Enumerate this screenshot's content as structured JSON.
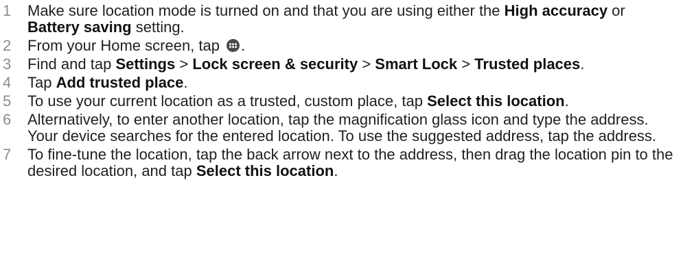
{
  "steps": [
    {
      "num": "1",
      "parts": [
        {
          "t": "Make sure location mode is turned on and that you are using either the "
        },
        {
          "t": "High accuracy",
          "b": true
        },
        {
          "t": " or "
        },
        {
          "t": "Battery saving",
          "b": true
        },
        {
          "t": " setting."
        }
      ]
    },
    {
      "num": "2",
      "parts": [
        {
          "t": "From your Home screen, tap "
        },
        {
          "icon": "apps-grid-icon"
        },
        {
          "t": "."
        }
      ]
    },
    {
      "num": "3",
      "parts": [
        {
          "t": "Find and tap "
        },
        {
          "t": "Settings",
          "b": true
        },
        {
          "t": " > "
        },
        {
          "t": "Lock screen & security",
          "b": true
        },
        {
          "t": " > "
        },
        {
          "t": "Smart Lock",
          "b": true
        },
        {
          "t": " > "
        },
        {
          "t": "Trusted places",
          "b": true
        },
        {
          "t": "."
        }
      ]
    },
    {
      "num": "4",
      "parts": [
        {
          "t": "Tap "
        },
        {
          "t": "Add trusted place",
          "b": true
        },
        {
          "t": "."
        }
      ]
    },
    {
      "num": "5",
      "parts": [
        {
          "t": "To use your current location as a trusted, custom place, tap "
        },
        {
          "t": "Select this location",
          "b": true
        },
        {
          "t": "."
        }
      ]
    },
    {
      "num": "6",
      "parts": [
        {
          "t": "Alternatively, to enter another location, tap the magnification glass icon and type the address. Your device searches for the entered location. To use the suggested address, tap the address."
        }
      ]
    },
    {
      "num": "7",
      "parts": [
        {
          "t": "To fine-tune the location, tap the back arrow next to the address, then drag the location pin to the desired location, and tap "
        },
        {
          "t": "Select this location",
          "b": true
        },
        {
          "t": "."
        }
      ]
    }
  ]
}
